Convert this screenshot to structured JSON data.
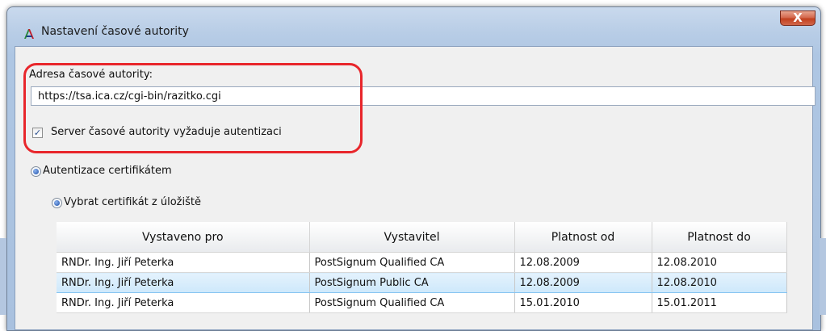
{
  "window": {
    "title": "Nastavení časové autority",
    "close_symbol": "X"
  },
  "authority": {
    "address_label": "Adresa časové autority:",
    "address_value": "https://tsa.ica.cz/cgi-bin/razitko.cgi",
    "auth_required_label": "Server časové autority vyžaduje autentizaci",
    "auth_required_checked": true
  },
  "options": {
    "cert_auth_label": "Autentizace certifikátem",
    "store_cert_label": "Vybrat certifikát z úložiště"
  },
  "table": {
    "columns": [
      "Vystaveno pro",
      "Vystavitel",
      "Platnost od",
      "Platnost do"
    ],
    "rows": [
      [
        "RNDr. Ing. Jiří Peterka",
        "PostSignum Qualified CA",
        "12.08.2009",
        "12.08.2010"
      ],
      [
        "RNDr. Ing. Jiří Peterka",
        "PostSignum Public CA",
        "12.08.2009",
        "12.08.2010"
      ],
      [
        "RNDr. Ing. Jiří Peterka",
        "PostSignum Qualified CA",
        "15.01.2010",
        "15.01.2011"
      ]
    ],
    "selected_row": 1
  },
  "colors": {
    "highlight": "#e8262b",
    "selection": "#cde8fb",
    "title_accent": "#1b4ea8"
  }
}
